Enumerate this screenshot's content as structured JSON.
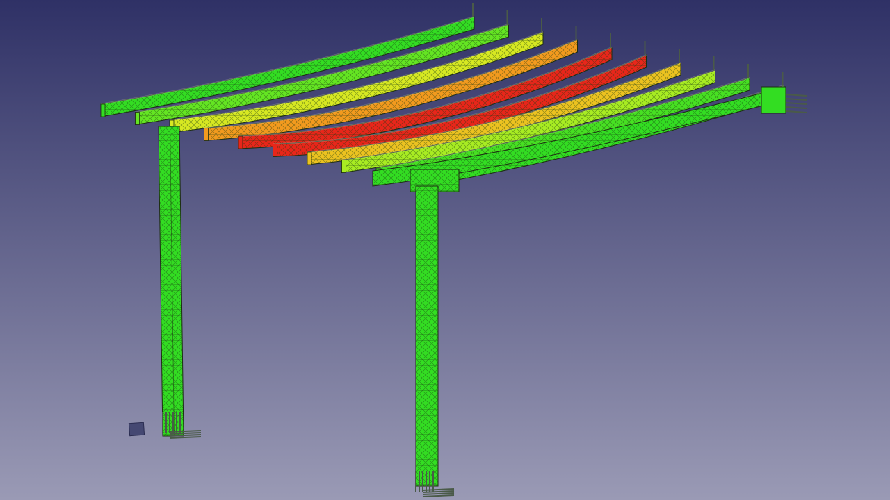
{
  "viewport": {
    "background_top": "#2f3166",
    "background_bottom": "#9a9ab5"
  },
  "model": {
    "beam_count": 10,
    "post_count": 2,
    "result_field": "displacement",
    "colormap": [
      "#33dd22",
      "#99ee22",
      "#e6e622",
      "#f29a1e",
      "#e8261a"
    ],
    "beam_displacement_levels": [
      0.0,
      0.12,
      0.45,
      0.75,
      1.0,
      1.0,
      0.62,
      0.3,
      0.05,
      0.0
    ],
    "mesh_color": "#1a3a12",
    "constraint_color": "#4a5a48"
  },
  "icons": {
    "navigation_cube": "navigation-cube-icon"
  }
}
